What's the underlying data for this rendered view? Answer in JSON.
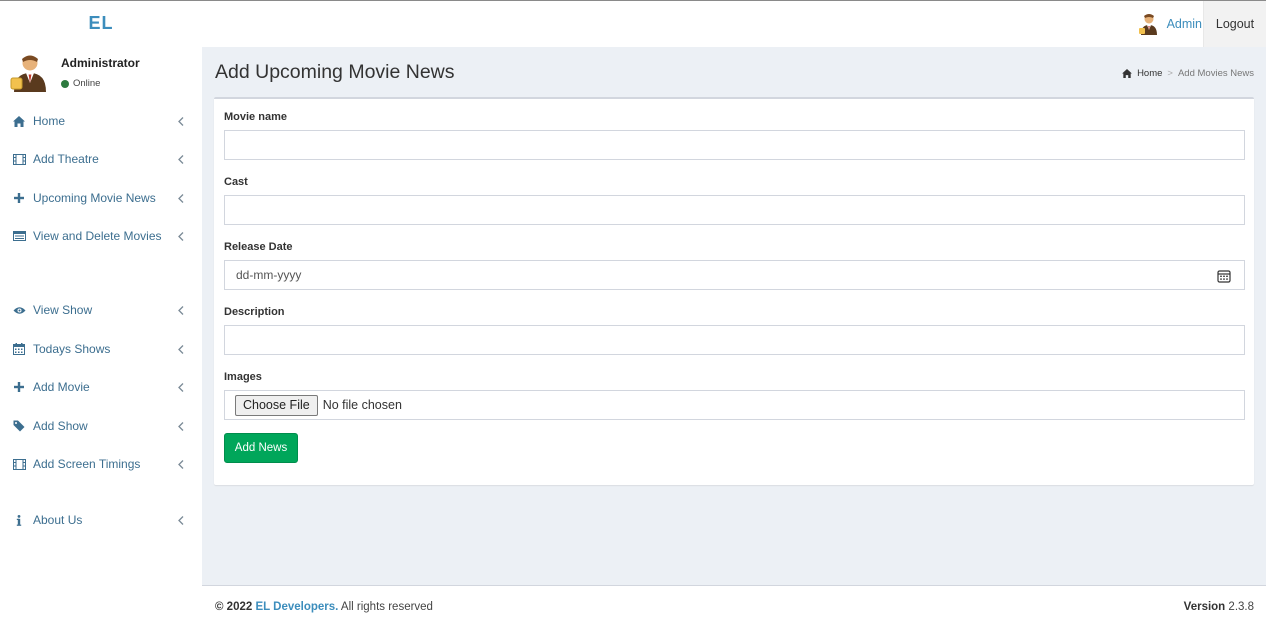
{
  "header": {
    "logo": "EL",
    "user_name": "Admin",
    "logout_label": "Logout"
  },
  "sidebar": {
    "user": {
      "name": "Administrator",
      "status": "Online"
    },
    "items": [
      {
        "label": "Home",
        "icon": "home-icon"
      },
      {
        "label": "Add Theatre",
        "icon": "film-icon"
      },
      {
        "label": "Upcoming Movie News",
        "icon": "plus-icon"
      },
      {
        "label": "View and Delete Movies",
        "icon": "list-icon"
      },
      {
        "label": "View Show",
        "icon": "eye-icon"
      },
      {
        "label": "Todays Shows",
        "icon": "calendar-icon"
      },
      {
        "label": "Add Movie",
        "icon": "plus-icon"
      },
      {
        "label": "Add Show",
        "icon": "ticket-icon"
      },
      {
        "label": "Add Screen Timings",
        "icon": "film-icon"
      },
      {
        "label": "About Us",
        "icon": "info-icon"
      }
    ]
  },
  "main": {
    "title": "Add Upcoming Movie News",
    "breadcrumb": {
      "home": "Home",
      "separator": ">",
      "current": "Add Movies News"
    },
    "form": {
      "movie_name_label": "Movie name",
      "movie_name_value": "",
      "cast_label": "Cast",
      "cast_value": "",
      "release_date_label": "Release Date",
      "release_date_placeholder": "dd-mm-yyyy",
      "description_label": "Description",
      "description_value": "",
      "images_label": "Images",
      "choose_file_label": "Choose File",
      "no_file_text": "No file chosen",
      "submit_label": "Add News"
    }
  },
  "footer": {
    "copyright": "© 2022",
    "brand": "EL Developers.",
    "rights": "All rights reserved",
    "version_label": "Version",
    "version_value": "2.3.8"
  },
  "colors": {
    "accent": "#3c8dbc",
    "success": "#00a65a",
    "content_bg": "#ecf0f5"
  }
}
